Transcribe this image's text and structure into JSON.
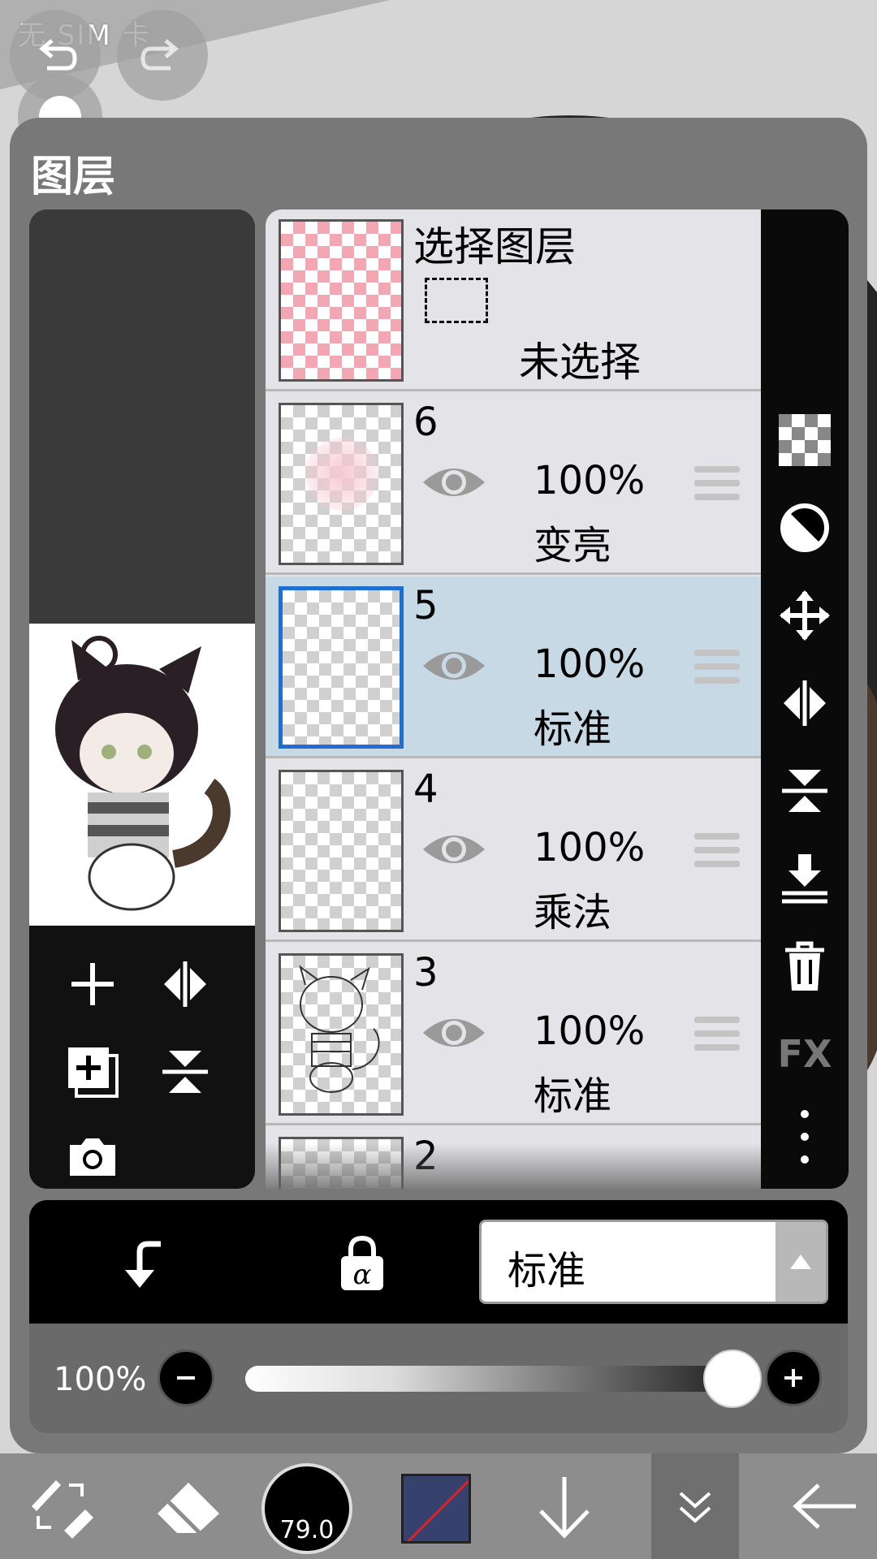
{
  "status_bar": {
    "carrier": "无 SIM 卡"
  },
  "panel": {
    "title": "图层"
  },
  "selection_layer": {
    "title": "选择图层",
    "state": "未选择"
  },
  "layers": [
    {
      "number": "6",
      "opacity": "100%",
      "blend": "变亮",
      "thumb": "plain",
      "selected": false
    },
    {
      "number": "5",
      "opacity": "100%",
      "blend": "标准",
      "thumb": "plain",
      "selected": true
    },
    {
      "number": "4",
      "opacity": "100%",
      "blend": "乘法",
      "thumb": "plain",
      "selected": false
    },
    {
      "number": "3",
      "opacity": "100%",
      "blend": "标准",
      "thumb": "sketch",
      "selected": false
    },
    {
      "number": "2"
    }
  ],
  "blend_mode": {
    "selected": "标准"
  },
  "opacity": {
    "label": "100%",
    "value": 1.0
  },
  "right_tools": {
    "fx_label": "FX"
  },
  "toolbar": {
    "brush_size": "79.0",
    "color": "#37416e"
  },
  "colors": {
    "selected_layer_bg": "#c8d9e6",
    "active_border": "#1e6fd1",
    "panel_bg": "#787878"
  }
}
